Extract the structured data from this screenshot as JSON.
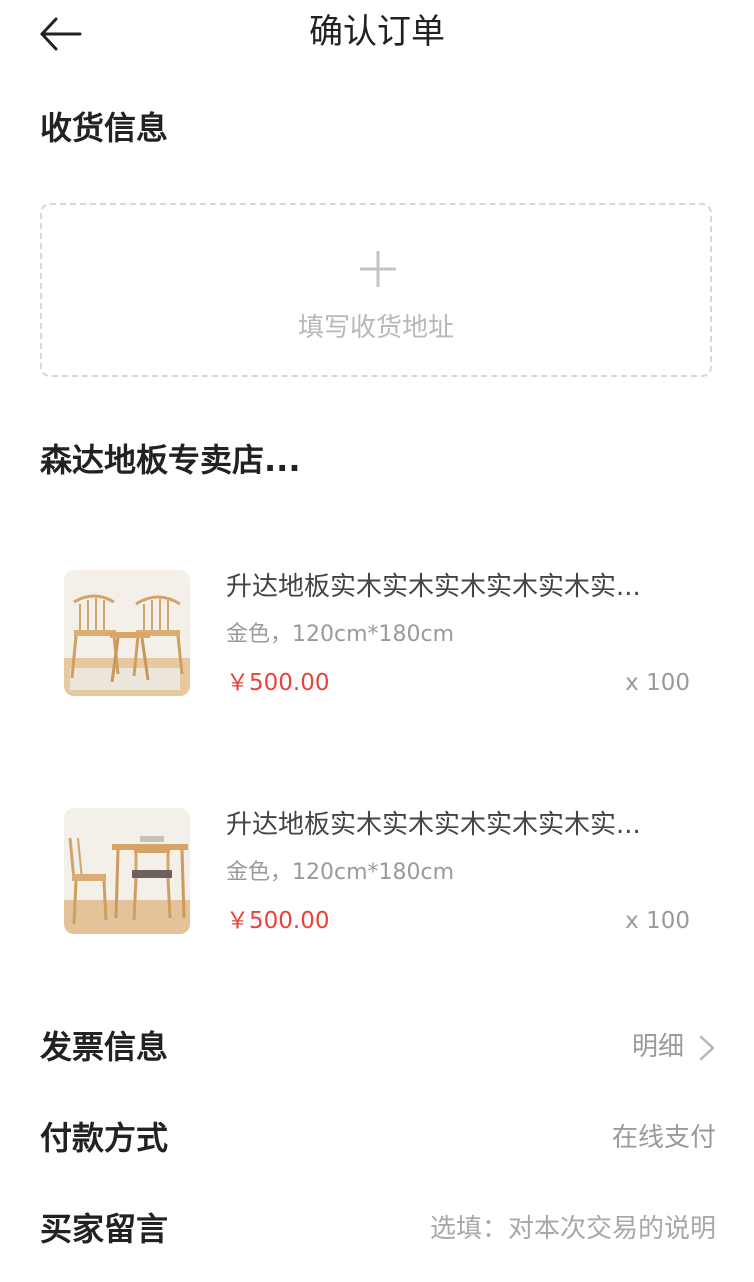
{
  "header": {
    "title": "确认订单"
  },
  "shipping": {
    "title": "收货信息",
    "add_label": "填写收货地址"
  },
  "store": {
    "name": "森达地板专卖店..."
  },
  "products": [
    {
      "name": "升达地板实木实木实木实木实木实...",
      "spec": "金色，120cm*180cm",
      "price": "￥500.00",
      "qty": "x 100",
      "image_icon": "chair-photo"
    },
    {
      "name": "升达地板实木实木实木实木实木实...",
      "spec": "金色，120cm*180cm",
      "price": "￥500.00",
      "qty": "x 100",
      "image_icon": "dining-set-photo"
    }
  ],
  "invoice": {
    "label": "发票信息",
    "value": "明细"
  },
  "payment": {
    "label": "付款方式",
    "value": "在线支付"
  },
  "message": {
    "label": "买家留言",
    "placeholder": "选填：对本次交易的说明"
  },
  "colors": {
    "price": "#e8423b",
    "muted": "#9a9a9a",
    "text": "#222222",
    "dashed_border": "#d7d7d7"
  }
}
